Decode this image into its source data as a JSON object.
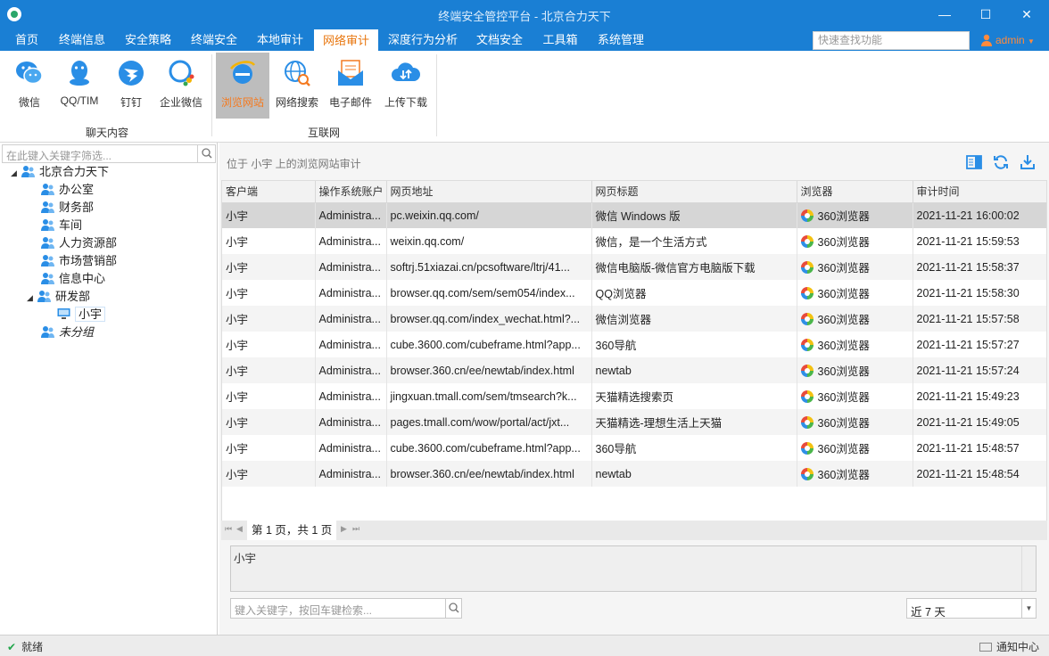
{
  "window": {
    "title": "终端安全管控平台 - 北京合力天下",
    "min": "—",
    "max": "☐",
    "close": "✕"
  },
  "menu": {
    "items": [
      "首页",
      "终端信息",
      "安全策略",
      "终端安全",
      "本地审计",
      "网络审计",
      "深度行为分析",
      "文档安全",
      "工具箱",
      "系统管理"
    ],
    "active": "网络审计",
    "search_placeholder": "快速查找功能",
    "user": "admin"
  },
  "ribbon": {
    "groups": [
      {
        "label": "聊天内容",
        "buttons": [
          "微信",
          "QQ/TIM",
          "钉钉",
          "企业微信"
        ]
      },
      {
        "label": "互联网",
        "buttons": [
          "浏览网站",
          "网络搜索",
          "电子邮件",
          "上传下载"
        ]
      }
    ],
    "active_button": "浏览网站"
  },
  "tree": {
    "search_placeholder": "在此键入关键字筛选...",
    "root": "北京合力天下",
    "groups": [
      "办公室",
      "财务部",
      "车间",
      "人力资源部",
      "市场营销部",
      "信息中心",
      "研发部"
    ],
    "rd_child": "小宇",
    "ungrouped": "未分组"
  },
  "main": {
    "location": "位于 小宇 上的浏览网站审计",
    "columns": [
      "客户端",
      "操作系统账户",
      "网页地址",
      "网页标题",
      "浏览器",
      "审计时间"
    ],
    "rows": [
      [
        "小宇",
        "Administra...",
        "pc.weixin.qq.com/",
        "微信 Windows 版",
        "360浏览器",
        "2021-11-21 16:00:02"
      ],
      [
        "小宇",
        "Administra...",
        "weixin.qq.com/",
        "微信，是一个生活方式",
        "360浏览器",
        "2021-11-21 15:59:53"
      ],
      [
        "小宇",
        "Administra...",
        "softrj.51xiazai.cn/pcsoftware/ltrj/41...",
        "微信电脑版-微信官方电脑版下载",
        "360浏览器",
        "2021-11-21 15:58:37"
      ],
      [
        "小宇",
        "Administra...",
        "browser.qq.com/sem/sem054/index...",
        "QQ浏览器",
        "360浏览器",
        "2021-11-21 15:58:30"
      ],
      [
        "小宇",
        "Administra...",
        "browser.qq.com/index_wechat.html?...",
        "微信浏览器",
        "360浏览器",
        "2021-11-21 15:57:58"
      ],
      [
        "小宇",
        "Administra...",
        "cube.3600.com/cubeframe.html?app...",
        "360导航",
        "360浏览器",
        "2021-11-21 15:57:27"
      ],
      [
        "小宇",
        "Administra...",
        "browser.360.cn/ee/newtab/index.html",
        "newtab",
        "360浏览器",
        "2021-11-21 15:57:24"
      ],
      [
        "小宇",
        "Administra...",
        "jingxuan.tmall.com/sem/tmsearch?k...",
        "天猫精选搜索页",
        "360浏览器",
        "2021-11-21 15:49:23"
      ],
      [
        "小宇",
        "Administra...",
        "pages.tmall.com/wow/portal/act/jxt...",
        "天猫精选-理想生活上天猫",
        "360浏览器",
        "2021-11-21 15:49:05"
      ],
      [
        "小宇",
        "Administra...",
        "cube.3600.com/cubeframe.html?app...",
        "360导航",
        "360浏览器",
        "2021-11-21 15:48:57"
      ],
      [
        "小宇",
        "Administra...",
        "browser.360.cn/ee/newtab/index.html",
        "newtab",
        "360浏览器",
        "2021-11-21 15:48:54"
      ]
    ],
    "pager": "第 1 页，共 1 页",
    "pager_first": "⏮",
    "pager_prev": "◀",
    "pager_next": "▶",
    "pager_last": "⏭",
    "detail_text": "小宇",
    "keyword_placeholder": "键入关键字，按回车键检索...",
    "range": "近 7 天",
    "range_arrow": "▼"
  },
  "status": {
    "ready": "就绪",
    "ready_icon": "✔",
    "notify": "通知中心"
  },
  "colors": {
    "brand": "#1a7fd4",
    "active_text": "#f47a20",
    "user_icon": "#2a8ee6"
  }
}
